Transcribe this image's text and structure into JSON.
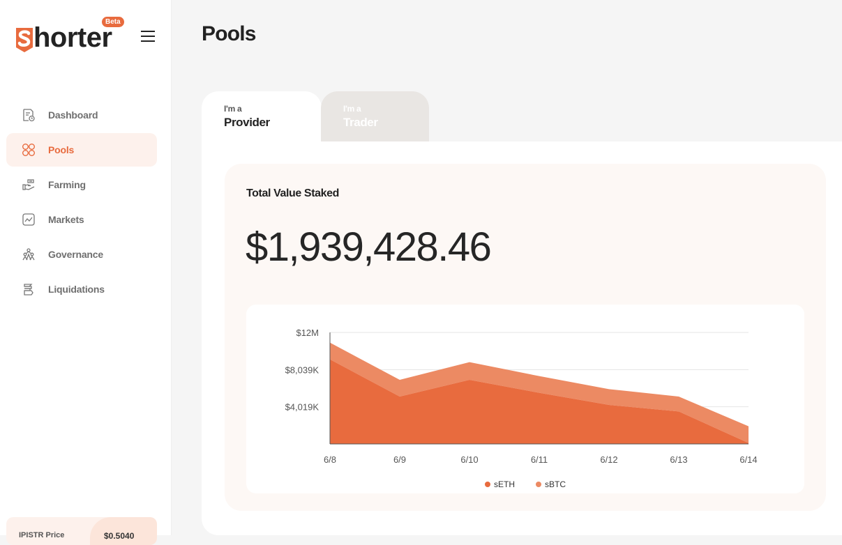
{
  "app": {
    "logo_text": "horter",
    "beta_badge": "Beta"
  },
  "sidebar": {
    "items": [
      {
        "label": "Dashboard",
        "icon": "dashboard-icon",
        "active": false
      },
      {
        "label": "Pools",
        "icon": "pools-icon",
        "active": true
      },
      {
        "label": "Farming",
        "icon": "farming-icon",
        "active": false
      },
      {
        "label": "Markets",
        "icon": "markets-icon",
        "active": false
      },
      {
        "label": "Governance",
        "icon": "governance-icon",
        "active": false
      },
      {
        "label": "Liquidations",
        "icon": "liquidations-icon",
        "active": false
      }
    ],
    "balance": {
      "label": "IPISTR Price",
      "value": "$0.5040"
    }
  },
  "page": {
    "title": "Pools"
  },
  "tabs": [
    {
      "small": "I'm a",
      "label": "Provider",
      "active": true
    },
    {
      "small": "I'm a",
      "label": "Trader",
      "active": false
    }
  ],
  "stats": {
    "title": "Total Value Staked",
    "value": "$1,939,428.46"
  },
  "colors": {
    "accent": "#e86b3e",
    "sETH": "#e86b3e",
    "sBTC": "#ec8a63"
  },
  "chart_data": {
    "type": "area",
    "stacked": true,
    "x": [
      "6/8",
      "6/9",
      "6/10",
      "6/11",
      "6/12",
      "6/13",
      "6/14"
    ],
    "y_ticks": [
      "$4,019K",
      "$8,039K",
      "$12M"
    ],
    "ylim": [
      0,
      12000000
    ],
    "grid": true,
    "legend": "bottom",
    "series": [
      {
        "name": "sETH",
        "values": [
          9100000,
          5100000,
          6900000,
          5500000,
          4200000,
          3500000,
          100000
        ]
      },
      {
        "name": "sBTC",
        "values": [
          1800000,
          1800000,
          1900000,
          1800000,
          1700000,
          1600000,
          1800000
        ]
      }
    ]
  }
}
